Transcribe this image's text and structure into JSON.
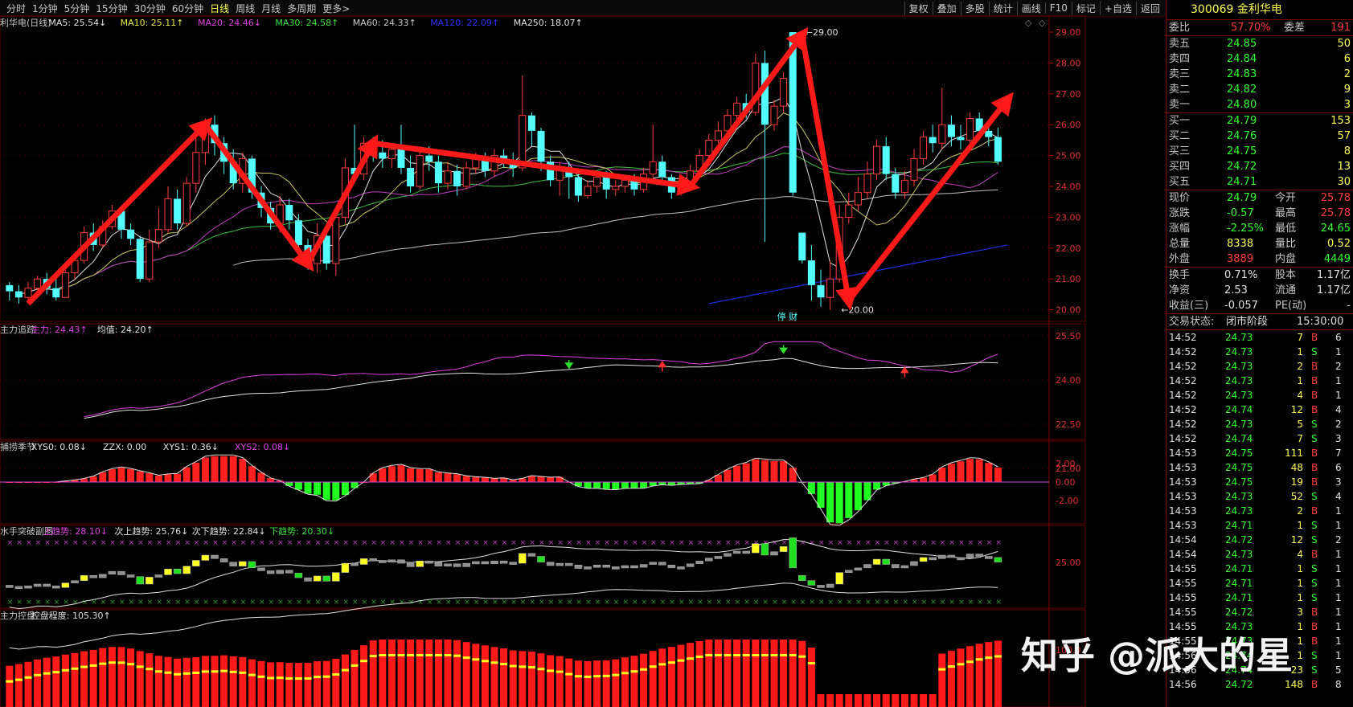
{
  "toolbar": {
    "periods": [
      "分时",
      "1分钟",
      "5分钟",
      "15分钟",
      "30分钟",
      "60分钟",
      "日线",
      "周线",
      "月线",
      "多周期",
      "更多>"
    ],
    "active": "日线",
    "tools": [
      "复权",
      "叠加",
      "多股",
      "统计",
      "画线",
      "F10",
      "标记",
      "+自选",
      "返回"
    ]
  },
  "main_legend": [
    {
      "text": "利华电(日线)",
      "color": "#c8c8c8"
    },
    {
      "text": "MA5: 25.54↓",
      "color": "#e0e0e0"
    },
    {
      "text": "MA10: 25.11↑",
      "color": "#e8e84a"
    },
    {
      "text": "MA20: 24.46↓",
      "color": "#e040e0"
    },
    {
      "text": "MA30: 24.58↑",
      "color": "#40e040"
    },
    {
      "text": "MA60: 24.33↑",
      "color": "#c8c8c8"
    },
    {
      "text": "MA120: 22.09↑",
      "color": "#3030ff"
    },
    {
      "text": "MA250: 18.07↑",
      "color": "#e0e0e0"
    }
  ],
  "sub1_legend": [
    {
      "text": "主力追踪",
      "color": "#c8c8c8"
    },
    {
      "text": "主力: 24.43↑",
      "color": "#e040e0"
    },
    {
      "text": "均值: 24.20↑",
      "color": "#e0e0e0"
    }
  ],
  "sub2_legend": [
    {
      "text": "捕捞季节",
      "color": "#c8c8c8"
    },
    {
      "text": "XYS0: 0.08↓",
      "color": "#e0e0e0"
    },
    {
      "text": "ZZX: 0.00",
      "color": "#e0e0e0"
    },
    {
      "text": "XYS1: 0.36↓",
      "color": "#e0e0e0"
    },
    {
      "text": "XYS2: 0.08↓",
      "color": "#e040e0"
    }
  ],
  "sub3_legend": [
    {
      "text": "水手突破副图",
      "color": "#c8c8c8"
    },
    {
      "text": "上趋势: 28.10↓",
      "color": "#e040e0"
    },
    {
      "text": "次上趋势: 25.76↓",
      "color": "#e0e0e0"
    },
    {
      "text": "次下趋势: 22.84↓",
      "color": "#e0e0e0"
    },
    {
      "text": "下趋势: 20.30↓",
      "color": "#40e040"
    }
  ],
  "sub4_legend": [
    {
      "text": "主力控盘",
      "color": "#c8c8c8"
    },
    {
      "text": "控盘程度: 105.30↑",
      "color": "#e0e0e0"
    }
  ],
  "chart_data": {
    "type": "candlestick",
    "y_ticks_main": [
      "29.00",
      "28.00",
      "27.00",
      "26.00",
      "25.00",
      "24.00",
      "23.00",
      "22.00",
      "21.00",
      "20.00"
    ],
    "y_ticks_sub1": [
      "25.50",
      "24.00",
      "22.50",
      "21.00"
    ],
    "y_ticks_sub2": [
      "2.00",
      "0.00",
      "-2.00"
    ],
    "y_ticks_sub3": [
      "25.00"
    ],
    "y_ticks_sub4": [
      "100.0"
    ],
    "high_label": "29.00",
    "low_label": "20.00",
    "event_label": "停 财",
    "candles": [
      [
        20.8,
        20.6,
        20.9,
        20.3
      ],
      [
        20.6,
        20.4,
        20.8,
        20.2
      ],
      [
        20.4,
        20.7,
        20.9,
        20.2
      ],
      [
        20.7,
        21.0,
        21.1,
        20.5
      ],
      [
        21.0,
        20.7,
        21.2,
        20.5
      ],
      [
        20.7,
        20.4,
        21.0,
        20.3
      ],
      [
        20.4,
        21.2,
        21.4,
        20.4
      ],
      [
        21.2,
        21.6,
        21.8,
        21.0
      ],
      [
        21.6,
        22.5,
        22.7,
        21.5
      ],
      [
        22.5,
        22.1,
        22.8,
        21.9
      ],
      [
        22.1,
        22.7,
        22.9,
        22.0
      ],
      [
        22.7,
        23.2,
        23.4,
        22.6
      ],
      [
        23.2,
        22.6,
        23.3,
        22.3
      ],
      [
        22.6,
        22.3,
        22.8,
        22.1
      ],
      [
        22.3,
        21.0,
        22.4,
        20.9
      ],
      [
        21.0,
        22.2,
        22.6,
        20.9
      ],
      [
        22.2,
        22.6,
        23.3,
        22.0
      ],
      [
        22.6,
        23.6,
        24.0,
        22.5
      ],
      [
        23.6,
        22.8,
        23.9,
        22.6
      ],
      [
        22.8,
        24.1,
        24.3,
        22.7
      ],
      [
        24.1,
        25.1,
        25.7,
        23.8
      ],
      [
        25.1,
        26.0,
        26.2,
        24.7
      ],
      [
        26.0,
        25.4,
        26.3,
        25.0
      ],
      [
        25.4,
        24.8,
        25.6,
        24.4
      ],
      [
        24.8,
        24.1,
        25.2,
        23.9
      ],
      [
        24.1,
        24.9,
        25.1,
        23.8
      ],
      [
        24.9,
        23.8,
        25.0,
        23.6
      ],
      [
        23.8,
        23.3,
        24.0,
        23.0
      ],
      [
        23.3,
        22.8,
        23.5,
        22.6
      ],
      [
        22.8,
        23.4,
        23.7,
        22.5
      ],
      [
        23.4,
        22.9,
        23.6,
        22.6
      ],
      [
        22.9,
        22.1,
        23.1,
        21.8
      ],
      [
        22.1,
        21.5,
        22.3,
        21.3
      ],
      [
        21.5,
        22.4,
        22.8,
        21.2
      ],
      [
        22.4,
        21.5,
        22.6,
        21.3
      ],
      [
        21.5,
        23.0,
        23.3,
        21.1
      ],
      [
        23.0,
        24.6,
        24.9,
        22.8
      ],
      [
        24.6,
        24.4,
        26.0,
        24.2
      ],
      [
        24.4,
        25.4,
        25.6,
        24.2
      ],
      [
        25.4,
        25.1,
        25.6,
        24.8
      ],
      [
        25.1,
        24.9,
        25.5,
        24.6
      ],
      [
        24.9,
        25.2,
        25.4,
        24.6
      ],
      [
        25.2,
        24.6,
        26.0,
        24.4
      ],
      [
        24.6,
        24.0,
        25.0,
        23.8
      ],
      [
        24.0,
        25.0,
        25.3,
        23.9
      ],
      [
        25.0,
        24.8,
        25.3,
        24.5
      ],
      [
        24.8,
        24.1,
        25.0,
        23.8
      ],
      [
        24.1,
        24.5,
        24.8,
        23.9
      ],
      [
        24.5,
        24.0,
        24.7,
        23.7
      ],
      [
        24.0,
        24.6,
        24.8,
        23.9
      ],
      [
        24.6,
        24.9,
        25.1,
        24.4
      ],
      [
        24.9,
        24.5,
        25.1,
        24.3
      ],
      [
        24.5,
        25.0,
        25.2,
        24.3
      ],
      [
        25.0,
        24.8,
        25.2,
        24.6
      ],
      [
        24.8,
        24.6,
        25.1,
        24.3
      ],
      [
        24.6,
        26.3,
        27.6,
        24.5
      ],
      [
        26.3,
        25.8,
        26.4,
        25.3
      ],
      [
        25.8,
        24.8,
        25.9,
        24.5
      ],
      [
        24.8,
        24.2,
        25.0,
        24.0
      ],
      [
        24.2,
        24.6,
        24.8,
        23.7
      ],
      [
        24.6,
        24.3,
        24.8,
        23.6
      ],
      [
        24.3,
        23.7,
        24.5,
        23.5
      ],
      [
        23.7,
        24.0,
        24.2,
        23.6
      ],
      [
        24.0,
        24.3,
        24.5,
        23.8
      ],
      [
        24.3,
        23.9,
        24.5,
        23.6
      ],
      [
        23.9,
        24.0,
        24.2,
        23.7
      ],
      [
        24.0,
        24.2,
        24.3,
        23.8
      ],
      [
        24.2,
        23.9,
        24.4,
        23.7
      ],
      [
        23.9,
        24.4,
        24.6,
        23.8
      ],
      [
        24.4,
        24.8,
        26.0,
        24.3
      ],
      [
        24.8,
        24.3,
        25.0,
        24.1
      ],
      [
        24.3,
        23.8,
        24.4,
        23.6
      ],
      [
        23.8,
        24.0,
        24.2,
        23.7
      ],
      [
        24.0,
        24.5,
        24.7,
        23.9
      ],
      [
        24.5,
        25.0,
        25.2,
        24.4
      ],
      [
        25.0,
        25.5,
        25.7,
        24.9
      ],
      [
        25.5,
        25.8,
        26.1,
        25.4
      ],
      [
        25.8,
        26.3,
        26.5,
        25.6
      ],
      [
        26.3,
        26.7,
        26.9,
        26.1
      ],
      [
        26.7,
        26.4,
        27.0,
        26.2
      ],
      [
        26.4,
        28.0,
        28.3,
        26.3
      ],
      [
        28.0,
        26.0,
        28.4,
        22.2
      ],
      [
        26.0,
        26.6,
        26.8,
        25.8
      ],
      [
        26.6,
        27.5,
        27.7,
        26.4
      ],
      [
        29.0,
        23.8,
        29.0,
        23.7
      ],
      [
        22.5,
        21.6,
        22.5,
        21.5
      ],
      [
        21.6,
        20.8,
        22.1,
        20.3
      ],
      [
        20.8,
        20.4,
        21.3,
        20.1
      ],
      [
        20.4,
        21.0,
        21.6,
        20.0
      ],
      [
        21.0,
        23.0,
        23.4,
        20.9
      ],
      [
        23.0,
        23.4,
        23.8,
        22.8
      ],
      [
        23.4,
        23.8,
        24.3,
        23.2
      ],
      [
        23.8,
        24.4,
        24.8,
        23.6
      ],
      [
        24.4,
        25.3,
        25.5,
        24.2
      ],
      [
        25.3,
        24.4,
        25.6,
        24.2
      ],
      [
        24.4,
        23.8,
        24.6,
        23.6
      ],
      [
        23.8,
        24.2,
        24.5,
        23.6
      ],
      [
        24.2,
        24.9,
        25.2,
        24.0
      ],
      [
        24.9,
        25.6,
        25.8,
        24.7
      ],
      [
        25.6,
        25.4,
        26.0,
        25.1
      ],
      [
        25.4,
        26.0,
        27.2,
        25.2
      ],
      [
        26.0,
        25.6,
        26.3,
        25.3
      ],
      [
        25.6,
        25.5,
        26.0,
        25.2
      ],
      [
        25.5,
        26.2,
        26.4,
        25.3
      ],
      [
        26.2,
        25.8,
        26.4,
        25.5
      ],
      [
        25.8,
        25.6,
        26.0,
        25.3
      ],
      [
        25.6,
        24.8,
        25.9,
        24.7
      ]
    ],
    "arrows": [
      [
        2,
        20.2,
        21,
        26.0
      ],
      [
        21,
        26.0,
        32,
        21.5
      ],
      [
        32,
        21.5,
        39,
        25.4
      ],
      [
        39,
        25.4,
        73,
        24.0
      ],
      [
        73,
        24.0,
        85,
        28.9
      ],
      [
        85,
        28.9,
        90,
        20.3
      ],
      [
        90,
        20.3,
        107,
        26.8
      ]
    ],
    "sub_markers": [
      {
        "i": 60,
        "dir": "down",
        "color": "#30e030"
      },
      {
        "i": 70,
        "dir": "up",
        "color": "#ff3030"
      },
      {
        "i": 83,
        "dir": "down",
        "color": "#30e030"
      },
      {
        "i": 96,
        "dir": "up",
        "color": "#ff3030"
      }
    ]
  },
  "quote": {
    "code_name": "300069 金利华电",
    "webi": {
      "label": "委比",
      "value": "57.70%",
      "label2": "委差",
      "value2": "191"
    },
    "sells": [
      {
        "label": "卖五",
        "price": "24.85",
        "vol": "50"
      },
      {
        "label": "卖四",
        "price": "24.84",
        "vol": "6"
      },
      {
        "label": "卖三",
        "price": "24.83",
        "vol": "2"
      },
      {
        "label": "卖二",
        "price": "24.82",
        "vol": "9"
      },
      {
        "label": "卖一",
        "price": "24.80",
        "vol": "3"
      }
    ],
    "buys": [
      {
        "label": "买一",
        "price": "24.79",
        "vol": "153"
      },
      {
        "label": "买二",
        "price": "24.76",
        "vol": "57"
      },
      {
        "label": "买三",
        "price": "24.75",
        "vol": "8"
      },
      {
        "label": "买四",
        "price": "24.72",
        "vol": "13"
      },
      {
        "label": "买五",
        "price": "24.71",
        "vol": "30"
      }
    ],
    "stats": [
      {
        "l1": "现价",
        "v1": "24.79",
        "c1": "#30ff30",
        "l2": "今开",
        "v2": "25.78",
        "c2": "#ff3c3c"
      },
      {
        "l1": "涨跌",
        "v1": "-0.57",
        "c1": "#30ff30",
        "l2": "最高",
        "v2": "25.78",
        "c2": "#ff3c3c"
      },
      {
        "l1": "涨幅",
        "v1": "-2.25%",
        "c1": "#30ff30",
        "l2": "最低",
        "v2": "24.65",
        "c2": "#30ff30"
      },
      {
        "l1": "总量",
        "v1": "8338",
        "c1": "#ffff54",
        "l2": "量比",
        "v2": "0.52",
        "c2": "#ffff54"
      },
      {
        "l1": "外盘",
        "v1": "3889",
        "c1": "#ff3c3c",
        "l2": "内盘",
        "v2": "4449",
        "c2": "#30ff30"
      }
    ],
    "fin": [
      {
        "l1": "换手",
        "v1": "0.71%",
        "l2": "股本",
        "v2": "1.17亿"
      },
      {
        "l1": "净资",
        "v1": "2.53",
        "l2": "流通",
        "v2": "1.17亿"
      },
      {
        "l1": "收益(三)",
        "v1": "-0.057",
        "l2": "PE(动)",
        "v2": "-"
      }
    ],
    "status": {
      "label": "交易状态:",
      "value": "闭市阶段",
      "time": "15:30:00"
    },
    "ticks": [
      [
        "14:52",
        "24.73",
        "7",
        "B",
        "6"
      ],
      [
        "14:52",
        "24.73",
        "1",
        "S",
        "1"
      ],
      [
        "14:52",
        "24.73",
        "2",
        "B",
        "2"
      ],
      [
        "14:52",
        "24.73",
        "1",
        "B",
        "1"
      ],
      [
        "14:52",
        "24.73",
        "4",
        "B",
        "1"
      ],
      [
        "14:52",
        "24.74",
        "12",
        "B",
        "4"
      ],
      [
        "14:52",
        "24.73",
        "5",
        "S",
        "2"
      ],
      [
        "14:52",
        "24.74",
        "7",
        "S",
        "3"
      ],
      [
        "14:53",
        "24.75",
        "111",
        "B",
        "7"
      ],
      [
        "14:53",
        "24.75",
        "48",
        "B",
        "6"
      ],
      [
        "14:53",
        "24.75",
        "19",
        "B",
        "3"
      ],
      [
        "14:53",
        "24.73",
        "52",
        "S",
        "4"
      ],
      [
        "14:53",
        "24.73",
        "2",
        "B",
        "1"
      ],
      [
        "14:53",
        "24.71",
        "1",
        "S",
        "1"
      ],
      [
        "14:54",
        "24.72",
        "12",
        "S",
        "2"
      ],
      [
        "14:54",
        "24.73",
        "4",
        "B",
        "1"
      ],
      [
        "14:55",
        "24.71",
        "1",
        "S",
        "1"
      ],
      [
        "14:55",
        "24.71",
        "1",
        "S",
        "1"
      ],
      [
        "14:55",
        "24.71",
        "1",
        "S",
        "1"
      ],
      [
        "14:55",
        "24.72",
        "3",
        "B",
        "1"
      ],
      [
        "14:55",
        "24.73",
        "1",
        "B",
        "1"
      ],
      [
        "14:55",
        "24.73",
        "1",
        "B",
        "1"
      ],
      [
        "14:56",
        "24.74",
        "1",
        "S",
        "1"
      ],
      [
        "14:56",
        "24.74",
        "23",
        "S",
        "5"
      ],
      [
        "14:56",
        "24.72",
        "148",
        "B",
        "8"
      ]
    ]
  },
  "watermark": "知乎 @派大的星"
}
